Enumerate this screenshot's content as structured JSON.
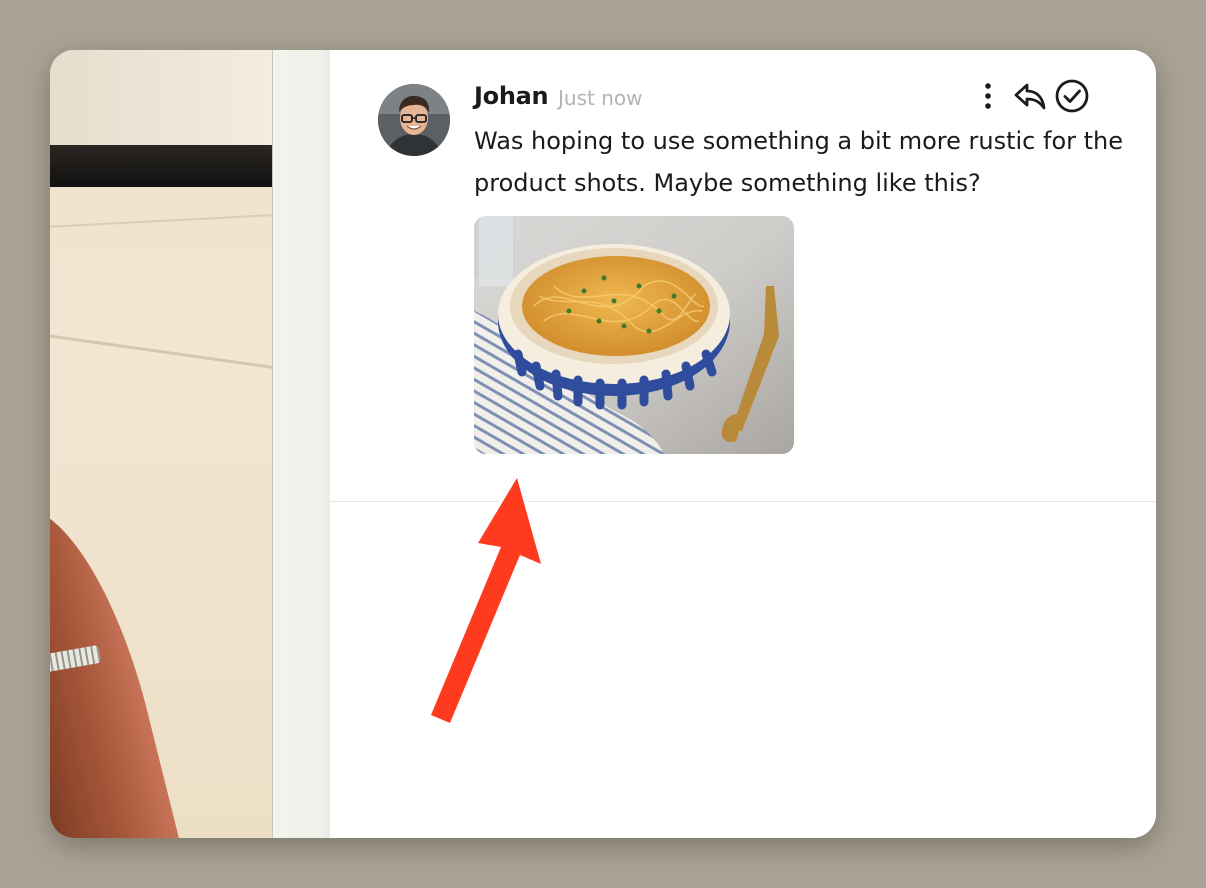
{
  "comment": {
    "author": "Johan",
    "timestamp": "Just now",
    "message": "Was hoping to use something a bit more rustic for the product shots. Maybe something like this?",
    "attachment": {
      "subject": "bowl of spaghetti with blue striped bowl and gold fork"
    }
  },
  "actions": [
    {
      "icon": "more-vertical-icon"
    },
    {
      "icon": "reply-icon"
    },
    {
      "icon": "resolve-check-icon"
    }
  ],
  "colors": {
    "annotation_arrow": "#ff3b1f",
    "text": "#1b1b1b",
    "timestamp": "#b3b3b3"
  }
}
